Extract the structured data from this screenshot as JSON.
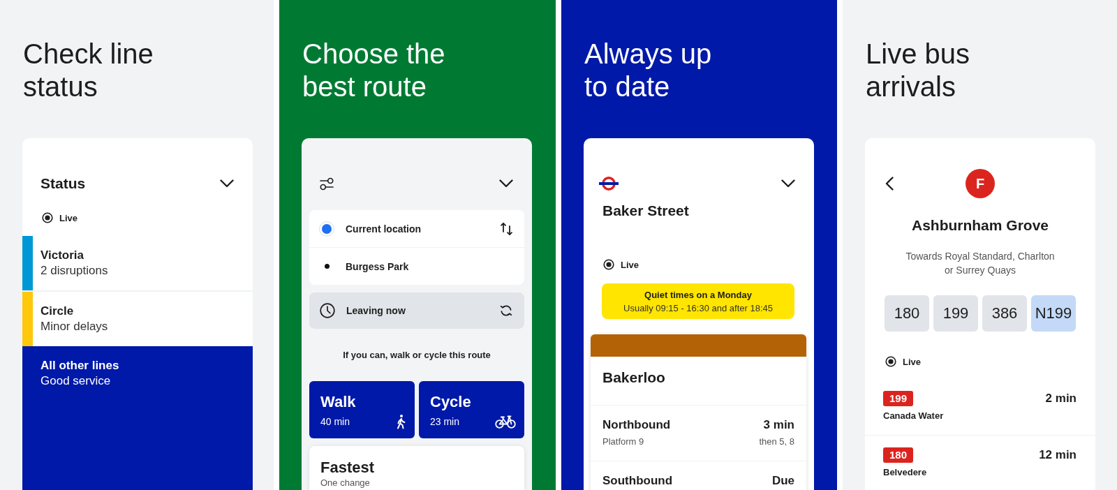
{
  "panels": [
    {
      "kind": "status",
      "color": "#f2f3f5",
      "heading": "Check line status",
      "card": {
        "title": "Status",
        "live_label": "Live",
        "lines": [
          {
            "kind": "line",
            "name": "Victoria",
            "status": "2 disruptions",
            "color": "#0098d4"
          },
          {
            "kind": "line",
            "name": "Circle",
            "status": "Minor delays",
            "color": "#ffc80a"
          },
          {
            "kind": "summary",
            "name": "All other lines",
            "status": "Good service",
            "color": "#0019a8"
          }
        ]
      }
    },
    {
      "kind": "journey",
      "color": "#007a33",
      "heading": "Choose the best route",
      "card": {
        "from": "Current location",
        "to": "Burgess Park",
        "time": "Leaving now",
        "hint": "If you can, walk or cycle this route",
        "modes": [
          {
            "kind": "walk",
            "label": "Walk",
            "duration": "40 min"
          },
          {
            "kind": "cycle",
            "label": "Cycle",
            "duration": "23 min"
          }
        ],
        "option": {
          "title": "Fastest",
          "detail": "One change"
        }
      }
    },
    {
      "kind": "station",
      "color": "#0019a8",
      "heading": "Always up to date",
      "card": {
        "station": "Baker Street",
        "live_label": "Live",
        "notice": {
          "title": "Quiet times on a Monday",
          "text": "Usually 09:15 - 16:30 and after 18:45"
        },
        "line": {
          "name": "Bakerloo",
          "color": "#b36305",
          "departures": [
            {
              "direction": "Northbound",
              "time": "3 min",
              "platform": "Platform 9",
              "next": "then 5, 8"
            },
            {
              "direction": "Southbound",
              "time": "Due"
            }
          ]
        }
      }
    },
    {
      "kind": "bus_stop",
      "color": "#f2f3f5",
      "heading": "Live bus arrivals",
      "card": {
        "stop_letter": "F",
        "stop_name": "Ashburnham Grove",
        "direction": "Towards Royal Standard, Charlton or Surrey Quays",
        "routes": [
          {
            "label": "180",
            "selected": false
          },
          {
            "label": "199",
            "selected": false
          },
          {
            "label": "386",
            "selected": false
          },
          {
            "label": "N199",
            "selected": true
          }
        ],
        "live_label": "Live",
        "arrivals": [
          {
            "route": "199",
            "destination": "Canada Water",
            "time": "2 min"
          },
          {
            "route": "180",
            "destination": "Belvedere",
            "time": "12 min"
          }
        ]
      }
    }
  ]
}
